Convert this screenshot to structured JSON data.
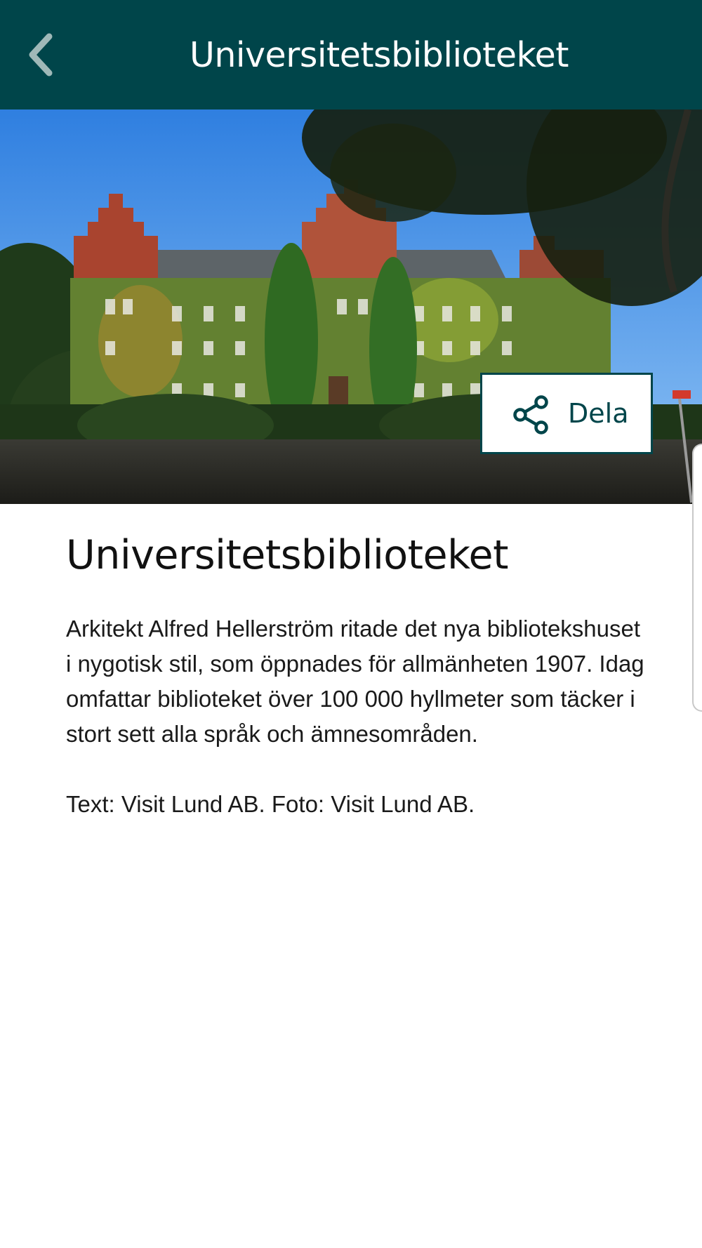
{
  "header": {
    "title": "Universitetsbiblioteket",
    "background_color": "#00454a",
    "back_icon": "chevron-left-icon"
  },
  "hero": {
    "image": "library-building-photo"
  },
  "share": {
    "label": "Dela",
    "icon": "share-icon"
  },
  "content": {
    "title": "Universitetsbiblioteket",
    "description": "Arkitekt Alfred Hellerström ritade det nya bibliotekshuset i nygotisk stil, som öppnades för allmänheten 1907. Idag omfattar biblioteket över 100 000 hyllmeter som täcker i stort sett alla språk och ämnesområden.",
    "credits": "Text: Visit Lund AB. Foto: Visit Lund AB."
  }
}
